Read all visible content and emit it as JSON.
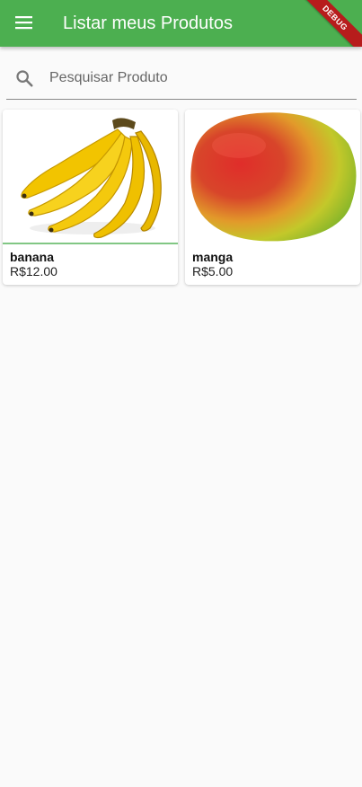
{
  "app_bar": {
    "title": "Listar meus Produtos",
    "debug_label": "DEBUG",
    "color": "#4caf50",
    "menu_icon": "hamburger-menu-icon"
  },
  "search": {
    "placeholder": "Pesquisar Produto",
    "value": "",
    "icon": "search-icon"
  },
  "products": [
    {
      "name": "banana",
      "price": "R$12.00"
    },
    {
      "name": "manga",
      "price": "R$5.00"
    }
  ]
}
